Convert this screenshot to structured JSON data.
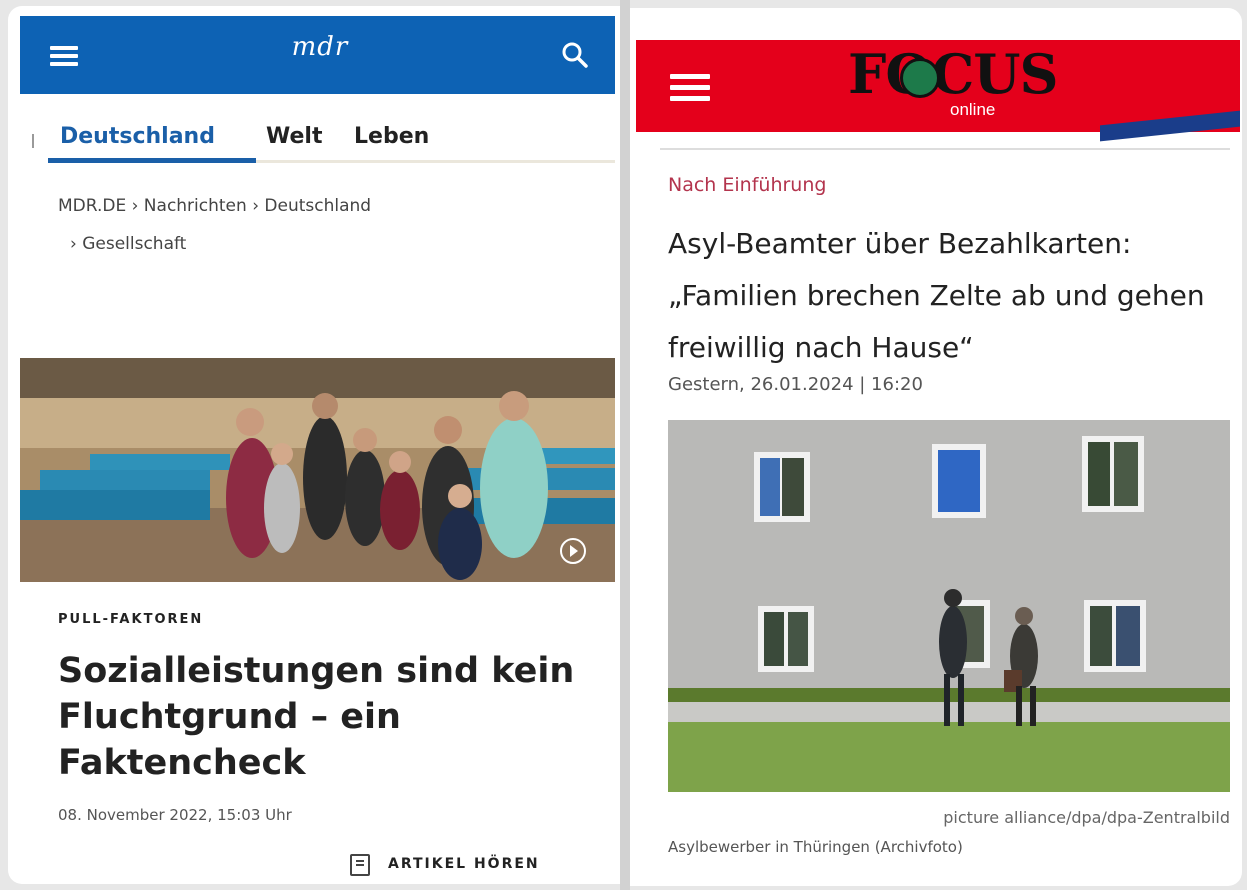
{
  "mdr": {
    "logo": "mdr",
    "tabs": [
      "Deutschland",
      "Welt",
      "Leben"
    ],
    "breadcrumb_line1": "MDR.DE › Nachrichten › Deutschland",
    "breadcrumb_line2": "› Gesellschaft",
    "kicker": "PULL-FAKTOREN",
    "headline": "Sozialleistungen sind kein Fluchtgrund – ein Faktencheck",
    "date": "08. November 2022, 15:03 Uhr",
    "listen_label": "ARTIKEL HÖREN",
    "brand_color": "#0d62b4"
  },
  "focus": {
    "logo": "FOCUS",
    "logo_sub": "online",
    "kicker": "Nach Einführung",
    "headline": "Asyl-Beamter über Bezahlkarten: „Familien brechen Zelte ab und gehen freiwillig nach Hause“",
    "date": "Gestern, 26.01.2024 | 16:20",
    "photo_credit": "picture alliance/dpa/dpa-Zentralbild",
    "caption": "Asylbewerber in Thüringen (Archivfoto)",
    "brand_color": "#e4001b"
  }
}
